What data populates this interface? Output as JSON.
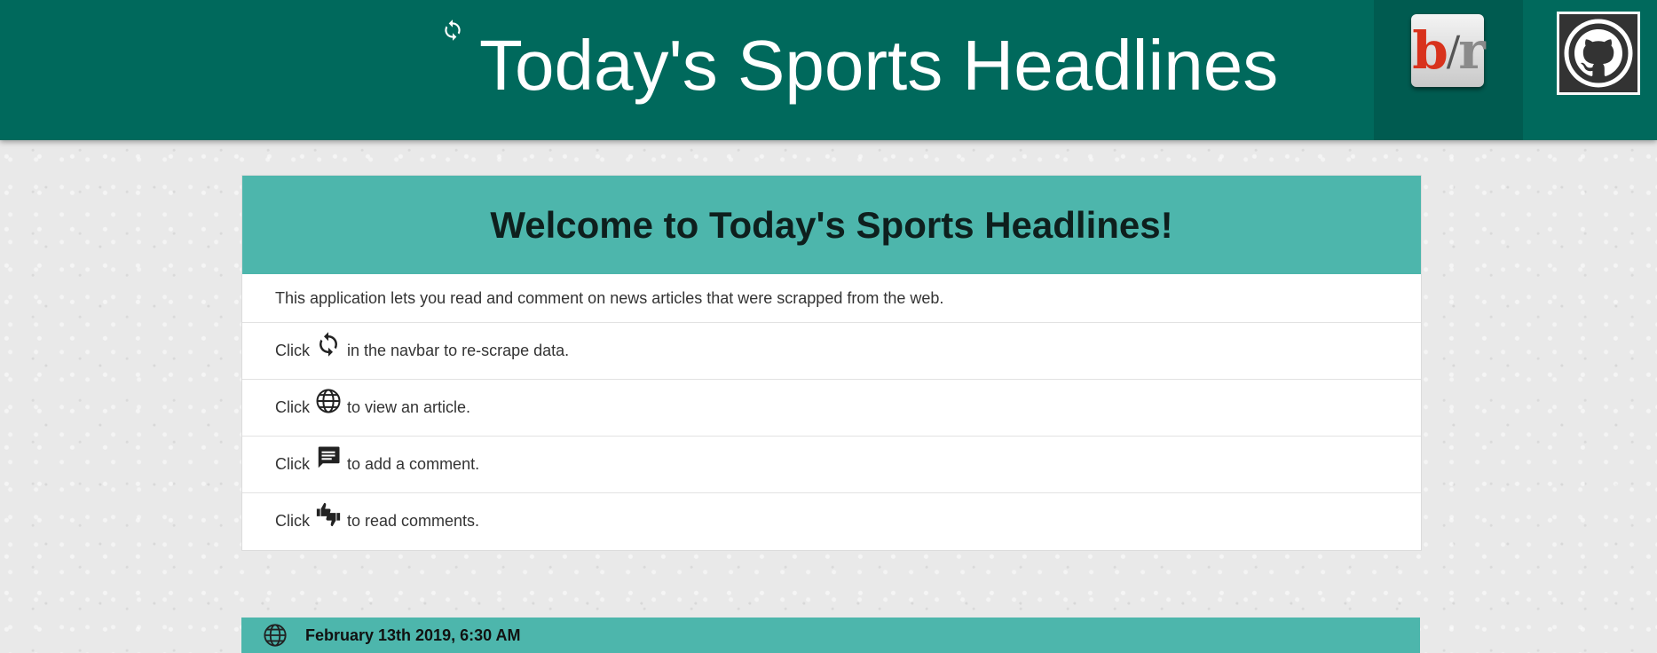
{
  "navbar": {
    "title": "Today's Sports Headlines",
    "refresh_icon": "refresh-icon",
    "brand_logo": "bleacher-report-logo",
    "github_icon": "github-icon",
    "background_color": "#00695c"
  },
  "welcome": {
    "heading": "Welcome to Today's Sports Headlines!",
    "intro": "This application lets you read and comment on news articles that were scrapped from the web.",
    "instructions": [
      {
        "prefix": "Click",
        "icon": "refresh-icon",
        "text": "in the navbar to re-scrape data."
      },
      {
        "prefix": "Click",
        "icon": "globe-icon",
        "text": "to view an article."
      },
      {
        "prefix": "Click",
        "icon": "comment-icon",
        "text": "to add a comment."
      },
      {
        "prefix": "Click",
        "icon": "thumbs-icon",
        "text": "to read comments."
      }
    ],
    "header_color": "#4db6ac"
  },
  "article": {
    "date": "February 13th 2019, 6:30 AM",
    "icon": "globe-icon"
  }
}
